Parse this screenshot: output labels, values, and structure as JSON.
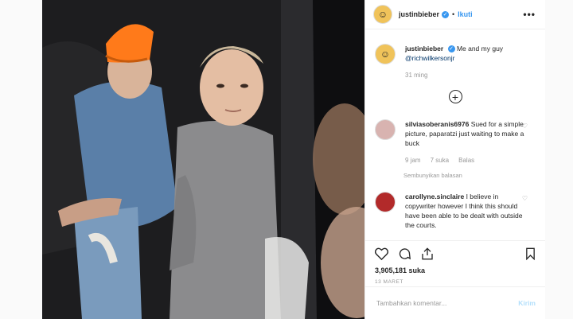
{
  "post": {
    "username": "justinbieber",
    "follow_label": "Ikuti",
    "caption_user": "justinbieber",
    "caption_text": "Me and my guy",
    "caption_mention": "@richwilkersonjr",
    "caption_time": "31 ming",
    "likes": "3,905,181 suka",
    "date": "13 MARET"
  },
  "comments": [
    {
      "user": "silviasoberanis6976",
      "text": "Sued for a simple picture, paparatzi just waiting to make a buck",
      "time": "9 jam",
      "likes": "7 suka",
      "reply": "Balas",
      "hide_replies": "Sembunyikan balasan"
    },
    {
      "user": "carollyne.sinclaire",
      "text": "I believe in copywriter however I think this should have been able to be dealt with outside the courts."
    }
  ],
  "add_comment": {
    "placeholder": "Tambahkan komentar...",
    "post_label": "Kirim"
  },
  "colors": {
    "accent": "#3897f0",
    "mention": "#003569",
    "post_disabled": "#b2dffc"
  },
  "icons": [
    "verified-icon",
    "more-icon",
    "add-reply-icon",
    "heart-icon",
    "comment-icon",
    "share-icon",
    "bookmark-icon"
  ]
}
